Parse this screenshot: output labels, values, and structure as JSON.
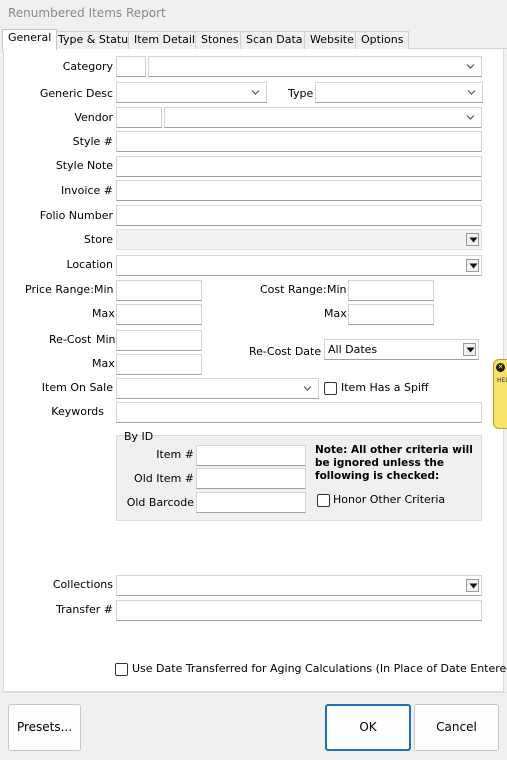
{
  "window": {
    "title": "Renumbered Items Report"
  },
  "tabs": [
    "General",
    "Type & Status",
    "Item Details",
    "Stones",
    "Scan Data",
    "Website",
    "Options"
  ],
  "active_tab": "General",
  "labels": {
    "category": "Category",
    "generic_desc": "Generic Desc",
    "type": "Type",
    "vendor": "Vendor",
    "style_no": "Style #",
    "style_note": "Style Note",
    "invoice_no": "Invoice #",
    "folio_number": "Folio Number",
    "store": "Store",
    "location": "Location",
    "price_range": "Price Range:",
    "min": "Min",
    "max": "Max",
    "cost_range": "Cost Range:",
    "recost": "Re-Cost",
    "recost_date": "Re-Cost Date",
    "item_on_sale": "Item On Sale",
    "keywords": "Keywords",
    "collections": "Collections",
    "transfer_no": "Transfer #"
  },
  "recost_date_value": "All Dates",
  "checkboxes": {
    "item_has_spiff": "Item Has a Spiff",
    "honor_other_criteria": "Honor Other Criteria",
    "use_date_transferred": "Use Date Transferred for Aging Calculations (In Place of Date Entered)"
  },
  "by_id": {
    "title": "By ID",
    "item_no": "Item #",
    "old_item_no": "Old Item #",
    "old_barcode": "Old Barcode",
    "note": "Note: All other criteria will be ignored unless the following is checked:"
  },
  "footer": {
    "presets": "Presets...",
    "ok": "OK",
    "cancel": "Cancel"
  },
  "help_tab": {
    "label": "HELP"
  },
  "colors": {
    "ok_border": "#1f6fc0",
    "help_tab": "#f7e36b"
  }
}
